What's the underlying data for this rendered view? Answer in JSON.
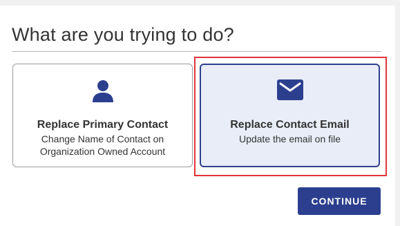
{
  "page": {
    "heading": "What are you trying to do?"
  },
  "options": [
    {
      "title": "Replace Primary Contact",
      "description": "Change Name of Contact on Organization Owned Account",
      "icon": "person-icon",
      "selected": false
    },
    {
      "title": "Replace Contact Email",
      "description": "Update the email on file",
      "icon": "envelope-icon",
      "selected": true
    }
  ],
  "actions": {
    "continue_label": "CONTINUE"
  },
  "colors": {
    "accent": "#2c3f8f",
    "selected_background": "#e8edf8",
    "highlight_outline": "#e2343a"
  }
}
